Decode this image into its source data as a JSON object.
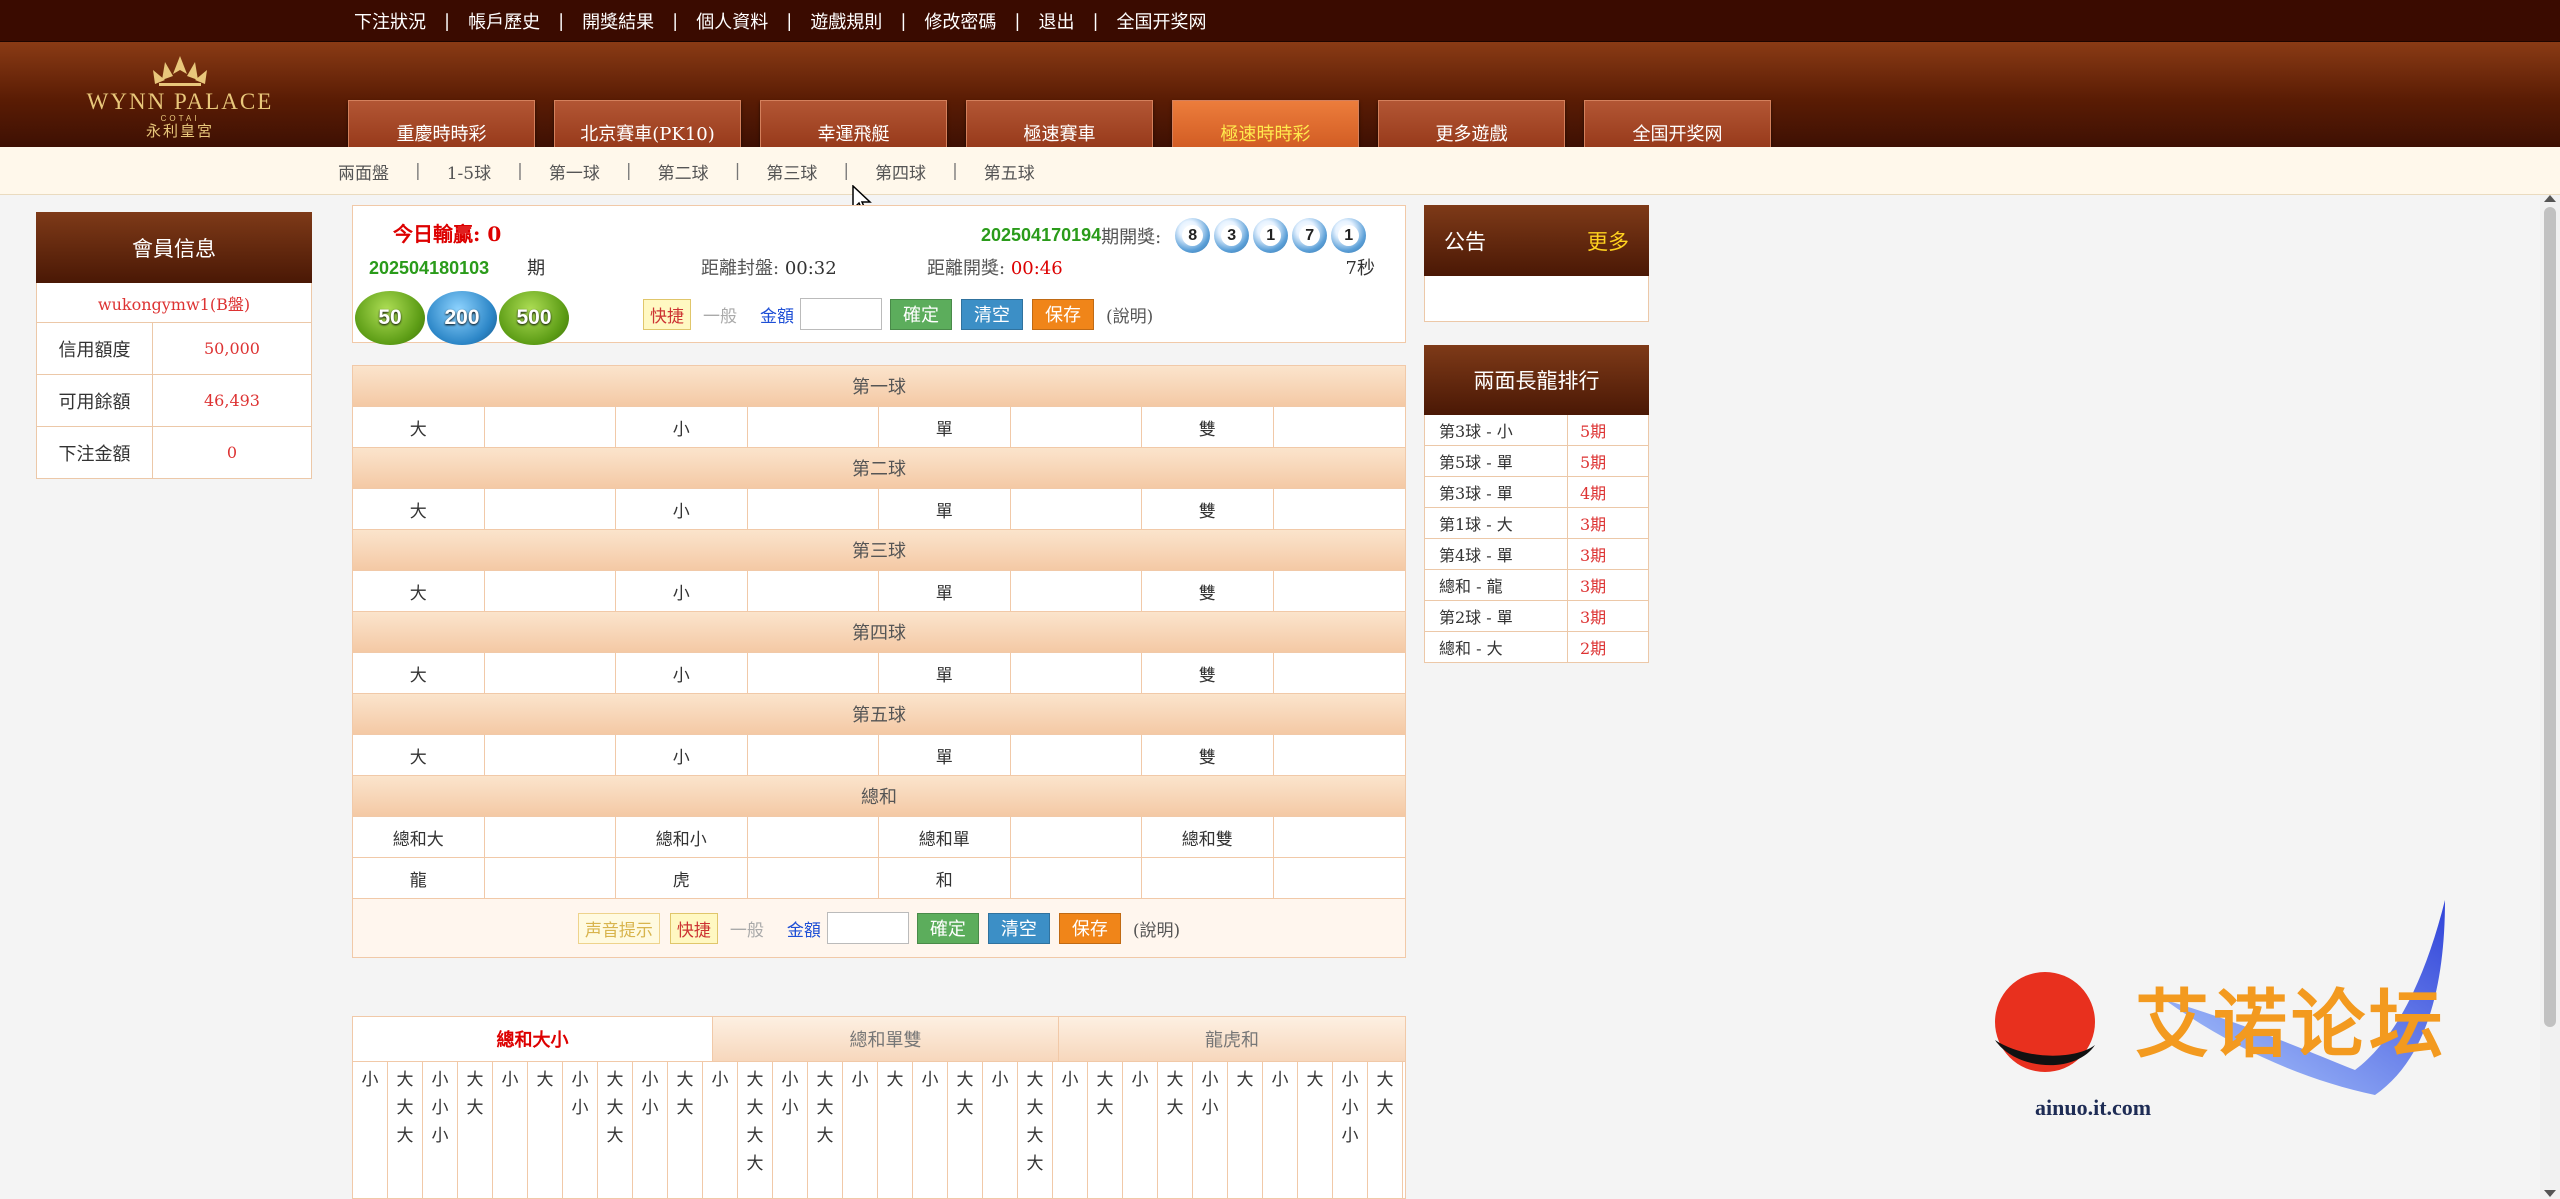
{
  "topbar": {
    "links": [
      "下注狀況",
      "帳戶歷史",
      "開獎結果",
      "個人資料",
      "遊戲規則",
      "修改密碼",
      "退出",
      "全国开奖网"
    ]
  },
  "logo": {
    "line1": "WYNN PALACE",
    "line2": "COTAI",
    "line3": "永利皇宮"
  },
  "games": {
    "items": [
      "重慶時時彩",
      "北京賽車(PK10)",
      "幸運飛艇",
      "極速賽車",
      "極速時時彩",
      "更多遊戲",
      "全国开奖网"
    ],
    "active": "極速時時彩"
  },
  "subnav": {
    "items": [
      "兩面盤",
      "1-5球",
      "第一球",
      "第二球",
      "第三球",
      "第四球",
      "第五球"
    ]
  },
  "member": {
    "title": "會員信息",
    "user": "wukongymw1(B盤)",
    "rows": [
      {
        "label": "信用額度",
        "value": "50,000"
      },
      {
        "label": "可用餘額",
        "value": "46,493"
      },
      {
        "label": "下注金額",
        "value": "0"
      }
    ]
  },
  "info": {
    "win_label": "今日輸贏:",
    "win_value": "0",
    "prev_issue": "202504170194",
    "prev_label": "期開獎:",
    "balls": [
      "8",
      "3",
      "1",
      "7",
      "1"
    ],
    "cur_issue": "202504180103",
    "cur_label": "期",
    "close_label": "距離封盤:",
    "close_time": "00:32",
    "open_label": "距離開獎:",
    "open_time": "00:46",
    "seconds": "7秒"
  },
  "chips": [
    "50",
    "200",
    "500"
  ],
  "controls": {
    "quick": "快捷",
    "normal": "一般",
    "amount_label": "金額",
    "confirm": "確定",
    "clear": "清空",
    "save": "保存",
    "note": "(說明)",
    "sound": "声音提示"
  },
  "sections": [
    {
      "title": "第一球",
      "items": [
        "大",
        "小",
        "單",
        "雙"
      ]
    },
    {
      "title": "第二球",
      "items": [
        "大",
        "小",
        "單",
        "雙"
      ]
    },
    {
      "title": "第三球",
      "items": [
        "大",
        "小",
        "單",
        "雙"
      ]
    },
    {
      "title": "第四球",
      "items": [
        "大",
        "小",
        "單",
        "雙"
      ]
    },
    {
      "title": "第五球",
      "items": [
        "大",
        "小",
        "單",
        "雙"
      ]
    }
  ],
  "sum_section": {
    "title": "總和",
    "row1": [
      "總和大",
      "總和小",
      "總和單",
      "總和雙"
    ],
    "row2": [
      "龍",
      "虎",
      "和"
    ]
  },
  "trend": {
    "tabs": [
      "總和大小",
      "總和單雙",
      "龍虎和"
    ],
    "active": "總和大小",
    "columns": [
      [
        "小"
      ],
      [
        "大",
        "大",
        "大"
      ],
      [
        "小",
        "小",
        "小"
      ],
      [
        "大",
        "大"
      ],
      [
        "小"
      ],
      [
        "大"
      ],
      [
        "小",
        "小"
      ],
      [
        "大",
        "大",
        "大"
      ],
      [
        "小",
        "小"
      ],
      [
        "大",
        "大"
      ],
      [
        "小"
      ],
      [
        "大",
        "大",
        "大",
        "大"
      ],
      [
        "小",
        "小"
      ],
      [
        "大",
        "大",
        "大"
      ],
      [
        "小"
      ],
      [
        "大"
      ],
      [
        "小"
      ],
      [
        "大",
        "大"
      ],
      [
        "小"
      ],
      [
        "大",
        "大",
        "大",
        "大"
      ],
      [
        "小"
      ],
      [
        "大",
        "大"
      ],
      [
        "小"
      ],
      [
        "大",
        "大"
      ],
      [
        "小",
        "小"
      ],
      [
        "大"
      ],
      [
        "小"
      ],
      [
        "大"
      ],
      [
        "小",
        "小",
        "小"
      ],
      [
        "大",
        "大"
      ]
    ]
  },
  "notice": {
    "title": "公告",
    "more": "更多"
  },
  "dragon": {
    "title": "兩面長龍排行",
    "rows": [
      {
        "name": "第3球 - 小",
        "periods": "5期"
      },
      {
        "name": "第5球 - 單",
        "periods": "5期"
      },
      {
        "name": "第3球 - 單",
        "periods": "4期"
      },
      {
        "name": "第1球 - 大",
        "periods": "3期"
      },
      {
        "name": "第4球 - 單",
        "periods": "3期"
      },
      {
        "name": "總和 - 龍",
        "periods": "3期"
      },
      {
        "name": "第2球 - 單",
        "periods": "3期"
      },
      {
        "name": "總和 - 大",
        "periods": "2期"
      }
    ]
  },
  "watermark": {
    "text": "艾诺论坛",
    "url": "ainuo.it.com"
  }
}
